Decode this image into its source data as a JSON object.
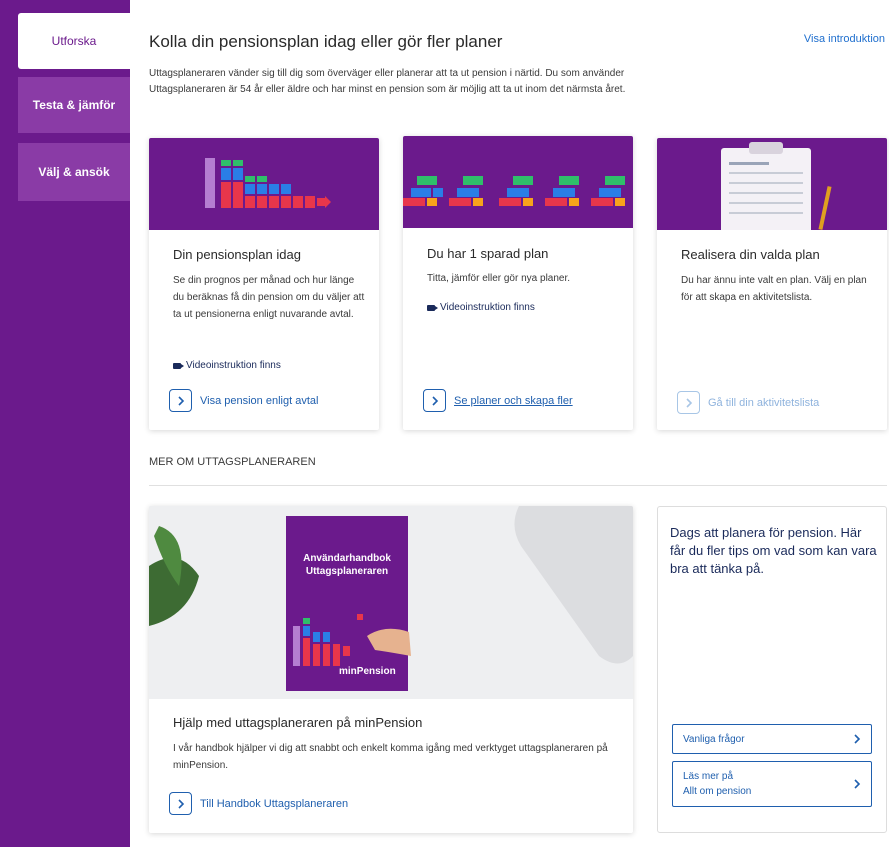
{
  "sidebar": {
    "tabs": [
      {
        "label": "Utforska"
      },
      {
        "label": "Testa & jämför"
      },
      {
        "label": "Välj & ansök"
      }
    ]
  },
  "header": {
    "title": "Kolla din pensionsplan idag eller gör fler planer",
    "intro_link": "Visa introduktion",
    "intro_text": "Uttagsplaneraren vänder sig till dig som överväger eller planerar att ta ut pension i närtid. Du som använder Uttagsplaneraren är 54 år eller äldre och har minst en pension som är möjlig att ta ut inom det närmsta året."
  },
  "cards": [
    {
      "title": "Din pensionsplan idag",
      "description": "Se din prognos per månad och hur länge du beräknas få din pension om du väljer att ta ut pensionerna enligt nuvarande avtal.",
      "video_note": "Videoinstruktion finns",
      "action": "Visa pension enligt avtal"
    },
    {
      "title": "Du har 1 sparad plan",
      "description": "Titta, jämför eller gör nya planer.",
      "video_note": "Videoinstruktion finns",
      "action": "Se planer och skapa fler"
    },
    {
      "title": "Realisera din valda plan",
      "description": "Du har ännu inte valt en plan. Välj en plan för att skapa en aktivitetslista.",
      "action": "Gå till din aktivitetslista"
    }
  ],
  "more_section": {
    "heading": "MER OM UTTAGSPLANERAREN",
    "handbook_card": {
      "book_title_line1": "Användarhandbok",
      "book_title_line2": "Uttagsplaneraren",
      "book_brand": "minPension",
      "title": "Hjälp med uttagsplaneraren på minPension",
      "description": "I vår handbok hjälper vi dig att snabbt och enkelt komma igång med verktyget uttagsplaneraren på minPension.",
      "action": "Till Handbok Uttagsplaneraren"
    },
    "tips_box": {
      "text": "Dags att planera för pension. Här får du fler tips om vad som kan vara bra att tänka på.",
      "link1": "Vanliga frågor",
      "link2_line1": "Läs mer på",
      "link2_line2": "Allt om pension"
    }
  },
  "colors": {
    "brand_purple": "#6b1a8c",
    "link_blue": "#1f5fae"
  }
}
